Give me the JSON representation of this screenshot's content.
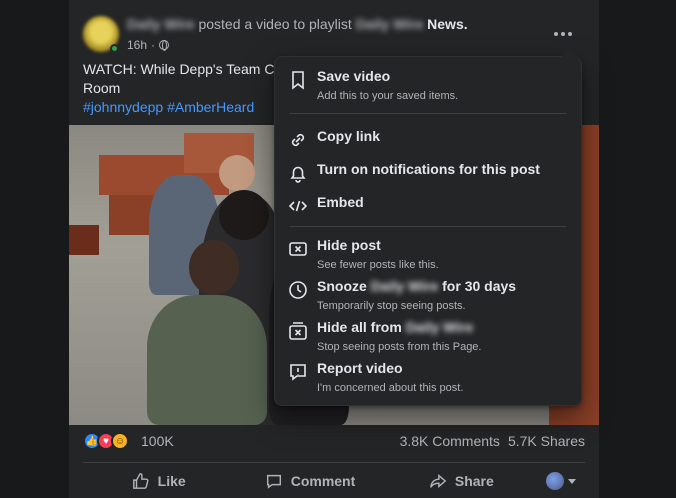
{
  "post": {
    "page_name": "Daily Wire",
    "action_text": "posted a video to playlist",
    "playlist_blurred": "Daily Wire",
    "playlist_name": "News.",
    "time": "16h",
    "dot": "·",
    "text_line": "WATCH: While Depp's Team CEL",
    "text_line2": "Room",
    "hashtag1": "#johnnydepp",
    "hashtag2": "#AmberHeard",
    "reaction_count": "100K",
    "comments": "3.8K Comments",
    "shares": "5.7K Shares"
  },
  "actions": {
    "like": "Like",
    "comment": "Comment",
    "share": "Share"
  },
  "menu": {
    "save_title": "Save video",
    "save_sub": "Add this to your saved items.",
    "copy_link": "Copy link",
    "notifications": "Turn on notifications for this post",
    "embed": "Embed",
    "hide_title": "Hide post",
    "hide_sub": "See fewer posts like this.",
    "snooze_prefix": "Snooze",
    "snooze_name": "Daily Wire",
    "snooze_suffix": "for 30 days",
    "snooze_sub": "Temporarily stop seeing posts.",
    "hide_all_prefix": "Hide all from",
    "hide_all_name": "Daily Wire",
    "hide_all_sub": "Stop seeing posts from this Page.",
    "report_title": "Report video",
    "report_sub": "I'm concerned about this post."
  },
  "icons": {
    "bookmark": "bookmark-icon",
    "link": "link-icon",
    "bell": "bell-icon",
    "code": "code-icon",
    "hide": "hide-x-icon",
    "clock": "clock-icon",
    "hide_all": "hide-all-icon",
    "report": "report-icon"
  },
  "colors": {
    "background": "#18191a",
    "surface": "#242526",
    "text_primary": "#e4e6eb",
    "text_secondary": "#b0b3b8",
    "link": "#4599ff",
    "online": "#31a24c"
  }
}
